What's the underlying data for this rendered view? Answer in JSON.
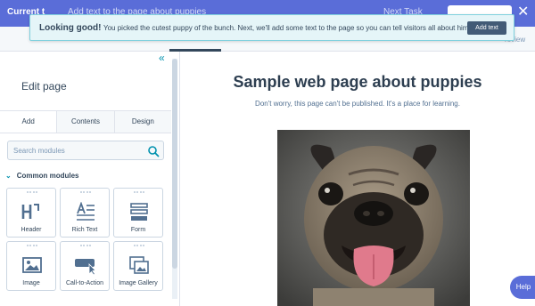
{
  "header": {
    "current_label": "Current t",
    "faded_text": "Add text to the page about puppies",
    "right_faded": "Next Task",
    "close_glyph": "✕"
  },
  "subbar": {
    "preview_label": "review"
  },
  "toast": {
    "title": "Looking good!",
    "message": "You picked the cutest puppy of the bunch. Next, we'll add some text to the page so you can tell visitors all about him.",
    "button_label": "Add text"
  },
  "sidebar": {
    "collapse_glyph": "«",
    "title": "Edit page",
    "tabs": [
      {
        "label": "Add"
      },
      {
        "label": "Contents"
      },
      {
        "label": "Design"
      }
    ],
    "search": {
      "placeholder": "Search modules",
      "value": ""
    },
    "section": {
      "label": "Common modules"
    },
    "modules": [
      {
        "label": "Header",
        "icon": "header-h1-icon"
      },
      {
        "label": "Rich Text",
        "icon": "rich-text-icon"
      },
      {
        "label": "Form",
        "icon": "form-icon"
      },
      {
        "label": "Image",
        "icon": "image-icon"
      },
      {
        "label": "Call-to-Action",
        "icon": "cta-icon"
      },
      {
        "label": "Image Gallery",
        "icon": "image-gallery-icon"
      }
    ]
  },
  "page": {
    "heading": "Sample web page about puppies",
    "subtext": "Don't worry, this page can't be published. It's a place for learning."
  },
  "help": {
    "label": "Help"
  },
  "colors": {
    "header_bg": "#5a6dd8",
    "toast_bg": "#e5f5f8",
    "toast_border": "#7fd1de",
    "accent": "#0091ae",
    "text_dark": "#33475b",
    "icon_blue": "#516f90"
  }
}
